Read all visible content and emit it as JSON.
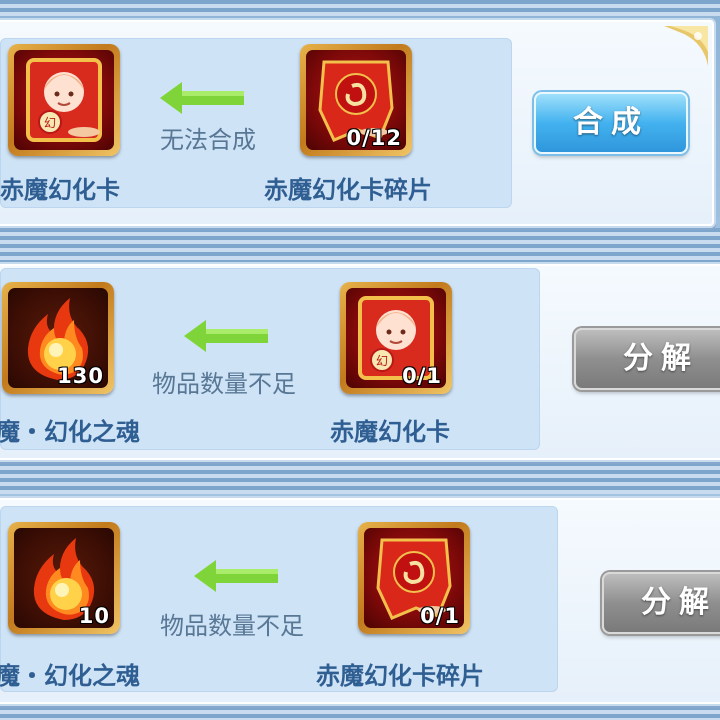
{
  "rows": [
    {
      "left_item": {
        "name": "赤魔幻化卡",
        "icon": "card-icon",
        "count": ""
      },
      "status": "无法合成",
      "right_item": {
        "name": "赤魔幻化卡碎片",
        "icon": "card-fragment-icon",
        "count": "0/12"
      },
      "button": {
        "label": "合成",
        "enabled": true
      }
    },
    {
      "left_item": {
        "name": "魔・幻化之魂",
        "icon": "flame-soul-icon",
        "count": "130"
      },
      "status": "物品数量不足",
      "right_item": {
        "name": "赤魔幻化卡",
        "icon": "card-icon",
        "count": "0/1"
      },
      "button": {
        "label": "分解",
        "enabled": false
      }
    },
    {
      "left_item": {
        "name": "魔・幻化之魂",
        "icon": "flame-soul-icon",
        "count": "10"
      },
      "status": "物品数量不足",
      "right_item": {
        "name": "赤魔幻化卡碎片",
        "icon": "card-fragment-icon",
        "count": "0/1"
      },
      "button": {
        "label": "分解",
        "enabled": false
      }
    }
  ],
  "colors": {
    "name_text": "#2f5e92",
    "status_text": "#587795",
    "arrow": "#7fd43a",
    "button_enabled": "#43b2ef",
    "button_disabled": "#8f8f8f"
  }
}
